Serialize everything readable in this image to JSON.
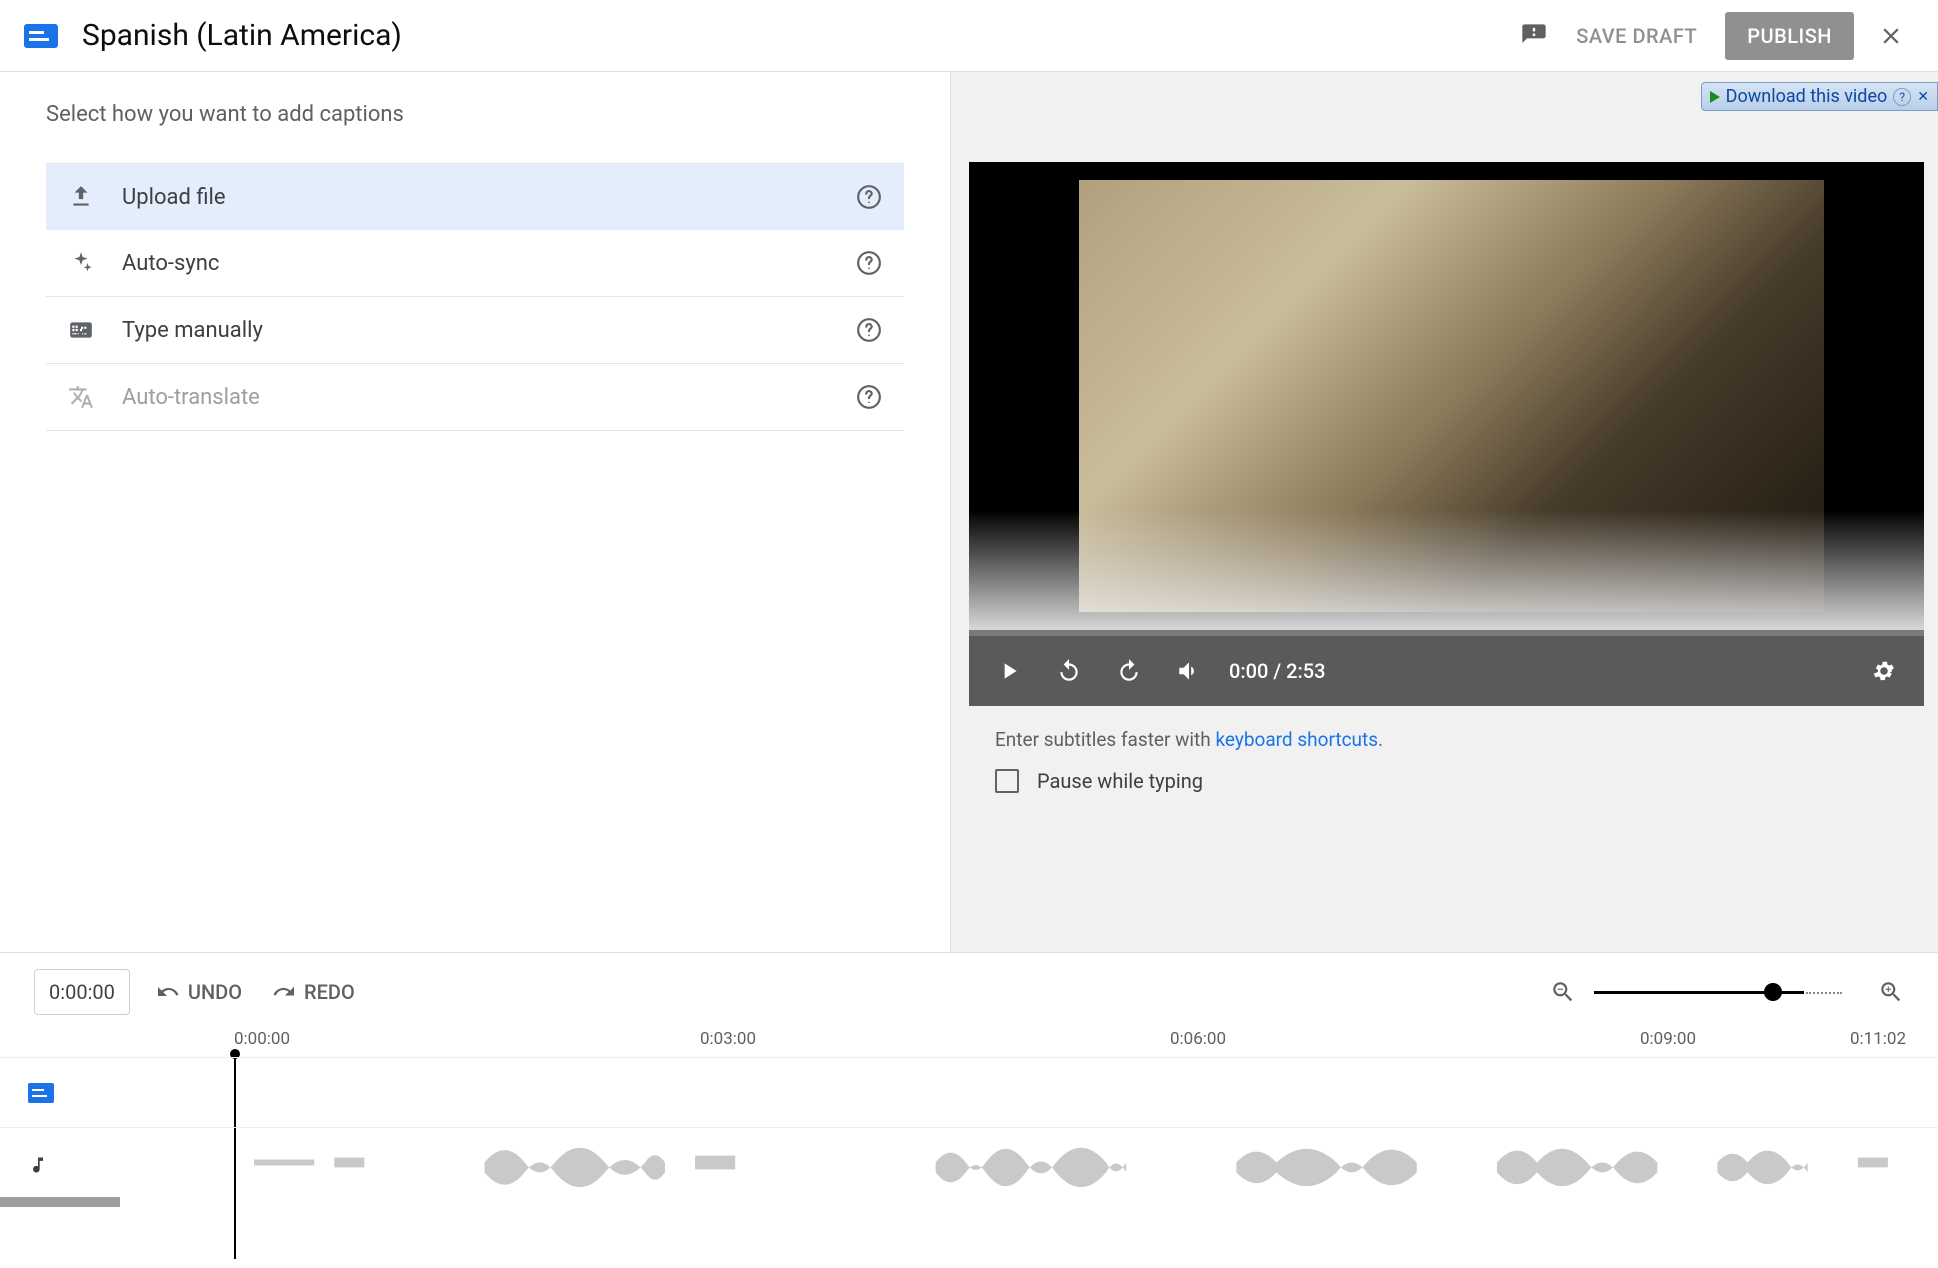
{
  "header": {
    "title": "Spanish (Latin America)",
    "save_draft": "SAVE DRAFT",
    "publish": "PUBLISH"
  },
  "left": {
    "heading": "Select how you want to add captions",
    "options": [
      {
        "label": "Upload file"
      },
      {
        "label": "Auto-sync"
      },
      {
        "label": "Type manually"
      },
      {
        "label": "Auto-translate"
      }
    ]
  },
  "download_bar": {
    "label": "Download this video"
  },
  "player": {
    "current_time": "0:00",
    "duration": "2:53",
    "time_display": "0:00 / 2:53"
  },
  "hint": {
    "prefix": "Enter subtitles faster with ",
    "link": "keyboard shortcuts",
    "suffix": "."
  },
  "pause_label": "Pause while typing",
  "timeline": {
    "time_input": "0:00:00",
    "undo": "UNDO",
    "redo": "REDO",
    "ticks": [
      "0:00:00",
      "0:03:00",
      "0:06:00",
      "0:09:00",
      "0:11:02"
    ]
  }
}
